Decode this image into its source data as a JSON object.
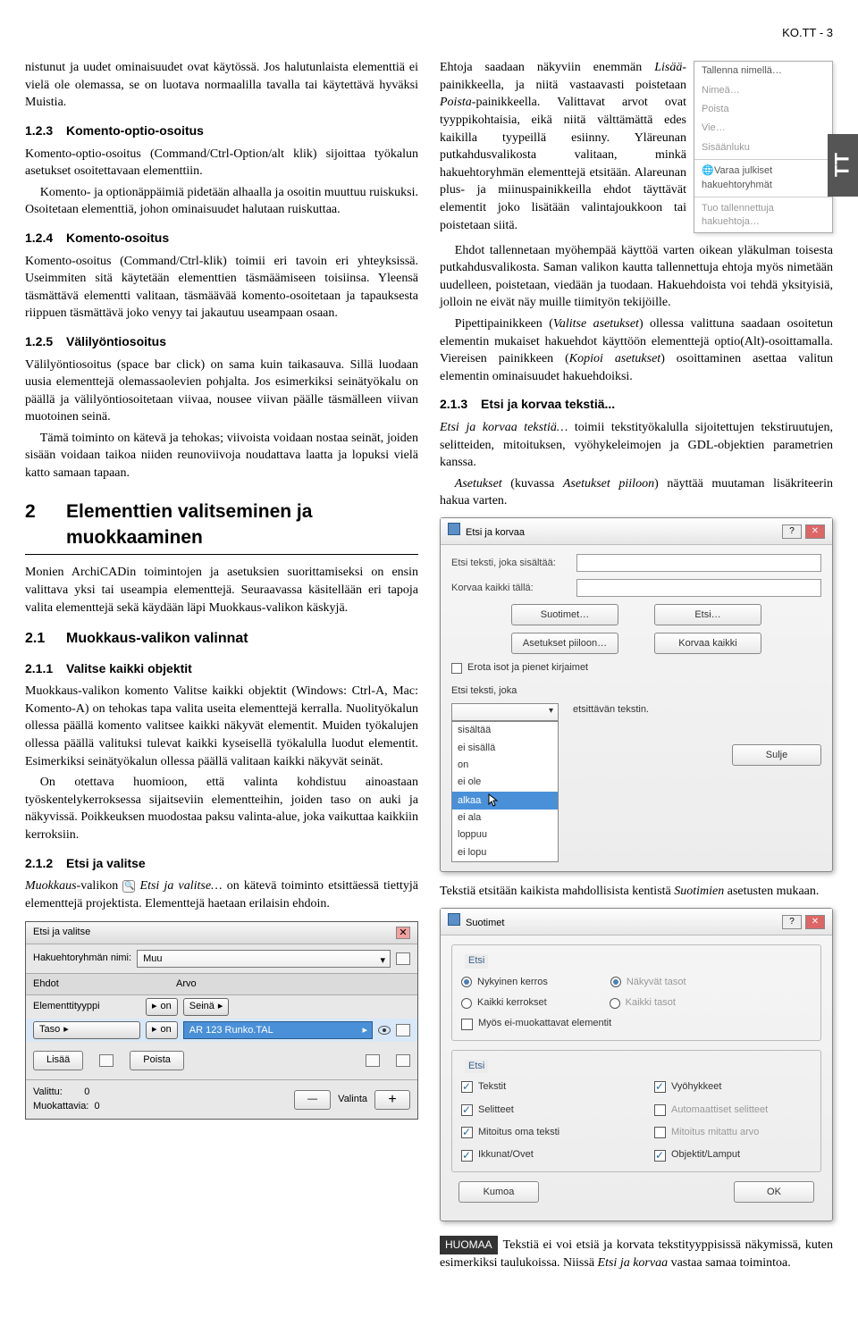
{
  "page_header": "KO.TT - 3",
  "side_tab": "TT",
  "left": {
    "intro": "nistunut ja uudet ominaisuudet ovat käytössä. Jos halutunlaista elementtiä ei vielä ole olemassa, se on luotava normaalilla tavalla tai käytettävä hyväksi Muistia.",
    "s123_num": "1.2.3",
    "s123_title": "Komento-optio-osoitus",
    "s123_p": "Komento-optio-osoitus (Command/Ctrl-Option/alt klik) sijoittaa työkalun asetukset osoitettavaan elementtiin.",
    "s123_p2": "Komento- ja optionäppäimiä pidetään alhaalla ja osoitin muuttuu ruiskuksi. Osoitetaan elementtiä, johon ominaisuudet halutaan ruiskuttaa.",
    "s124_num": "1.2.4",
    "s124_title": "Komento-osoitus",
    "s124_p": "Komento-osoitus (Command/Ctrl-klik) toimii eri tavoin eri yhteyksissä. Useimmiten sitä käytetään elementtien täsmäämiseen toisiinsa. Yleensä täsmättävä elementti valitaan, täsmäävää komento-osoitetaan ja tapauksesta riippuen täsmättävä joko venyy tai jakautuu useampaan osaan.",
    "s125_num": "1.2.5",
    "s125_title": "Välilyöntiosoitus",
    "s125_p1": "Välilyöntiosoitus (space bar click) on sama kuin taikasauva. Sillä luodaan uusia elementtejä olemassaolevien pohjalta. Jos esimerkiksi seinätyökalu on päällä ja välilyöntiosoitetaan viivaa, nousee viivan päälle täsmälleen viivan muotoinen seinä.",
    "s125_p2": "Tämä toiminto on kätevä ja tehokas; viivoista voidaan nostaa seinät, joiden sisään voidaan taikoa niiden reunoviivoja noudattava laatta ja lopuksi vielä katto samaan tapaan.",
    "s2_num": "2",
    "s2_title": "Elementtien valitseminen ja muokkaaminen",
    "s2_p": "Monien ArchiCADin toimintojen ja asetuksien suorittamiseksi on ensin valittava yksi tai useampia elementtejä. Seuraavassa käsitellään eri tapoja valita elementtejä sekä käydään läpi Muokkaus-valikon käskyjä.",
    "s21_num": "2.1",
    "s21_title": "Muokkaus-valikon valinnat",
    "s211_num": "2.1.1",
    "s211_title": "Valitse kaikki objektit",
    "s211_p1": "Muokkaus-valikon komento Valitse kaikki objektit (Windows: Ctrl-A, Mac: Komento-A) on tehokas tapa valita useita elementtejä kerralla. Nuolityökalun ollessa päällä komento valitsee kaikki näkyvät elementit. Muiden työkalujen ollessa päällä valituksi tulevat kaikki kyseisellä työkalulla luodut elementit. Esimerkiksi seinätyökalun ollessa päällä valitaan kaikki näkyvät seinät.",
    "s211_p2": "On otettava huomioon, että valinta kohdistuu ainoastaan työskentelykerroksessa sijaitseviin elementteihin, joiden taso on auki ja näkyvissä. Poikkeuksen muodostaa paksu valinta-alue, joka vaikuttaa kaikkiin kerroksiin.",
    "s212_num": "2.1.2",
    "s212_title": "Etsi ja valitse",
    "s212_p": "Muokkaus-valikon    Etsi ja valitse… on kätevä toiminto etsittäessä tiettyjä elementtejä projektista. Elementtejä haetaan erilaisin ehdoin.",
    "palette": {
      "title": "Etsi ja valitse",
      "label_group": "Hakuehtoryhmän nimi:",
      "group_value": "Muu",
      "col_ehdot": "Ehdot",
      "col_arvo": "Arvo",
      "row1_l": "Elementtityyppi",
      "row1_op": "on",
      "row1_v": "Seinä",
      "row2_l": "Taso",
      "row2_op": "on",
      "row2_v": "AR 123 Runko.TAL",
      "btn_add": "Lisää",
      "btn_remove": "Poista",
      "valittu": "Valittu:",
      "valittu_n": "0",
      "muok": "Muokattavia:",
      "muok_n": "0",
      "valinta": "Valinta"
    }
  },
  "right": {
    "p1a": "Ehtoja saadaan näkyviin enemmän Lisää-painikkeella, ja niitä vastaavasti poistetaan Poista-painikkeella. Valittavat arvot ovat tyyppikohtaisia, eikä niitä välttämättä edes kaikilla tyypeillä esiinny. Yläreunan putkahdusvalikosta valitaan, minkä hakuehtoryhmän elementtejä etsitään. Alareunan plus- ja miinuspainikkeilla ehdot täyttävät elementit joko lisätään valintajoukkoon tai poistetaan siitä.",
    "popup": {
      "i1": "Tallenna nimellä…",
      "i2": "Nimeä…",
      "i3": "Poista",
      "i4": "Vie…",
      "i5": "Sisäänluku",
      "i6": "Varaa julkiset hakuehtoryhmät",
      "i7": "Tuo tallennettuja hakuehtoja…"
    },
    "p2": "Ehdot tallennetaan myöhempää käyttöä varten oikean yläkulman toisesta putkahdusvalikosta. Saman valikon kautta tallennettuja ehtoja myös nimetään uudelleen, poistetaan, viedään ja tuodaan. Hakuehdoista voi tehdä yksityisiä, jolloin ne eivät näy muille tiimityön tekijöille.",
    "p3": "Pipettipainikkeen (Valitse asetukset) ollessa valittuna saadaan osoitetun elementin mukaiset hakuehdot käyttöön elementtejä optio(Alt)-osoittamalla. Viereisen painikkeen (Kopioi asetukset) osoittaminen asettaa valitun elementin ominaisuudet hakuehdoiksi.",
    "s213_num": "2.1.3",
    "s213_title": "Etsi ja korvaa tekstiä...",
    "s213_p1": "Etsi ja korvaa tekstiä… toimii tekstityökalulla sijoitettujen tekstiruutujen, selitteiden, mitoituksen, vyöhykeleimojen ja GDL-objektien parametrien kanssa.",
    "s213_p2": "Asetukset (kuvassa Asetukset piiloon) näyttää muutaman lisäkriteerin hakua varten.",
    "dialog1": {
      "title": "Etsi ja korvaa",
      "l1": "Etsi teksti, joka sisältää:",
      "l2": "Korvaa kaikki tällä:",
      "btn_suotimet": "Suotimet…",
      "btn_etsi": "Etsi…",
      "btn_piiloon": "Asetukset piiloon…",
      "btn_korvaa": "Korvaa kaikki",
      "cb_case": "Erota isot ja pienet kirjaimet",
      "l3": "Etsi teksti, joka",
      "l3_after": "etsittävän tekstin.",
      "options": [
        "sisältää",
        "ei sisällä",
        "on",
        "ei ole",
        "alkaa",
        "ei ala",
        "loppuu",
        "ei lopu"
      ],
      "selected": "alkaa",
      "btn_sulje": "Sulje"
    },
    "after_d1": "Tekstiä etsitään kaikista mahdollisista kentistä Suotimien asetusten mukaan.",
    "dialog2": {
      "title": "Suotimet",
      "g1": "Etsi",
      "r_nykyinen": "Nykyinen kerros",
      "r_kaikki": "Kaikki kerrokset",
      "r_nakyv_tasot": "Näkyvät tasot",
      "r_kaikki_tasot": "Kaikki tasot",
      "cb_ei": "Myös ei-muokattavat elementit",
      "g2": "Etsi",
      "cb_tekstit": "Tekstit",
      "cb_vyoh": "Vyöhykkeet",
      "cb_selitt": "Selitteet",
      "cb_auto": "Automaattiset selitteet",
      "cb_mitoitus": "Mitoitus oma teksti",
      "cb_mitattu": "Mitoitus mitattu arvo",
      "cb_ikkunat": "Ikkunat/Ovet",
      "cb_objektit": "Objektit/Lamput",
      "btn_kumoa": "Kumoa",
      "btn_ok": "OK"
    },
    "huomaa_label": "HUOMAA",
    "huomaa": "Tekstiä ei voi etsiä ja korvata tekstityyppisissä näkymissä, kuten esimerkiksi taulukoissa. Niissä Etsi ja korvaa vastaa samaa toimintoa."
  }
}
